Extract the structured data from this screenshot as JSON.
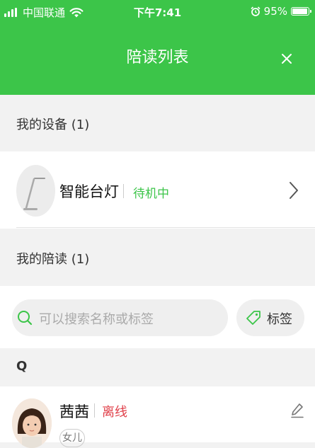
{
  "status_bar": {
    "carrier": "中国联通",
    "time": "下午7:41",
    "battery": "95%",
    "battery_level": 0.95
  },
  "header": {
    "title": "陪读列表",
    "bg_color": "#3cc549"
  },
  "devices_section": {
    "title": "我的设备 (1)"
  },
  "device": {
    "name": "智能台灯",
    "status": "待机中",
    "status_color": "#3cc549"
  },
  "readers_section": {
    "title": "我的陪读 (1)"
  },
  "search": {
    "placeholder": "可以搜索名称或标签",
    "tag_button_label": "标签"
  },
  "reader_group": {
    "letter": "Q"
  },
  "reader": {
    "name": "茜茜",
    "status": "离线",
    "status_color": "#e0404a",
    "tag": "女儿"
  },
  "icons": [
    "signal-icon",
    "wifi-icon",
    "alarm-icon",
    "battery-icon",
    "close-icon",
    "desk-lamp-icon",
    "chevron-right-icon",
    "search-icon",
    "tag-icon",
    "edit-icon",
    "avatar"
  ]
}
